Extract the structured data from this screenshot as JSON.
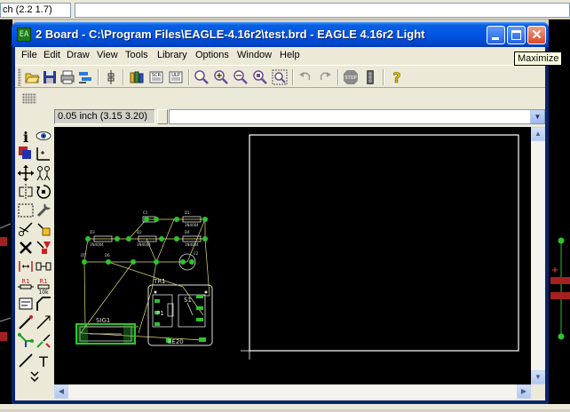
{
  "background_window": {
    "coordinate_readout": "ch (2.2 1.7)",
    "command_field": ""
  },
  "window": {
    "title": "2 Board - C:\\Program Files\\EAGLE-4.16r2\\test.brd - EAGLE 4.16r2 Light",
    "app_icon_text": "EA",
    "buttons": {
      "minimize": "minimize-icon",
      "maximize": "maximize-icon",
      "close": "close-icon"
    }
  },
  "menu": {
    "items": [
      "File",
      "Edit",
      "Draw",
      "View",
      "Tools",
      "Library",
      "Options",
      "Window",
      "Help"
    ]
  },
  "toolbar": {
    "icons": [
      "open-icon",
      "save-icon",
      "print-icon",
      "cam-icon",
      "schematic-icon",
      "library-icon",
      "script-icon",
      "ulp-icon",
      "zoom-fit-icon",
      "zoom-in-icon",
      "zoom-out-icon",
      "zoom-redraw-icon",
      "zoom-select-icon",
      "undo-icon",
      "redo-icon",
      "stop-icon",
      "go-icon",
      "help-icon"
    ],
    "stop_label": "STOP",
    "script_label": "SCR",
    "ulp_label": "ULP"
  },
  "coordbar": {
    "grid_coords": "0.05 inch (3.15 3.20)",
    "command_value": ""
  },
  "tooltip": {
    "text": "Maximize"
  },
  "board": {
    "parts": [
      "C1",
      "D1",
      "D2",
      "D3",
      "D4",
      "C2",
      "D5",
      "D6",
      "TR1",
      "SIG1",
      "S1",
      "P1",
      "EE20"
    ],
    "value_label": "1N4004",
    "part_labels": {
      "tr1": "TR1",
      "sig1": "SIG1",
      "s1": "S1",
      "p1": "P1",
      "ee20": "EE20",
      "c1": "C1",
      "c2": "C2"
    }
  },
  "palette": {
    "tools": [
      "info-icon",
      "show-icon",
      "display-icon",
      "mark-icon",
      "move-icon",
      "copy-icon",
      "mirror-icon",
      "rotate-icon",
      "group-icon",
      "change-icon",
      "cut-icon",
      "paste-icon",
      "delete-icon",
      "add-icon",
      "pinswap-icon",
      "replace-icon",
      "name-icon",
      "value-icon",
      "smash-icon",
      "miter-icon",
      "split-icon",
      "optimize-icon",
      "route-icon",
      "ripup-icon",
      "wire-icon",
      "text-icon",
      "more-icon"
    ],
    "name_label": "R1",
    "value_label": "10k"
  },
  "colors": {
    "canvas": "#000000",
    "outline": "#ffffff",
    "pad": "#2fc22f",
    "airwire": "#e6e07a",
    "title_bar": "#0055e5"
  }
}
